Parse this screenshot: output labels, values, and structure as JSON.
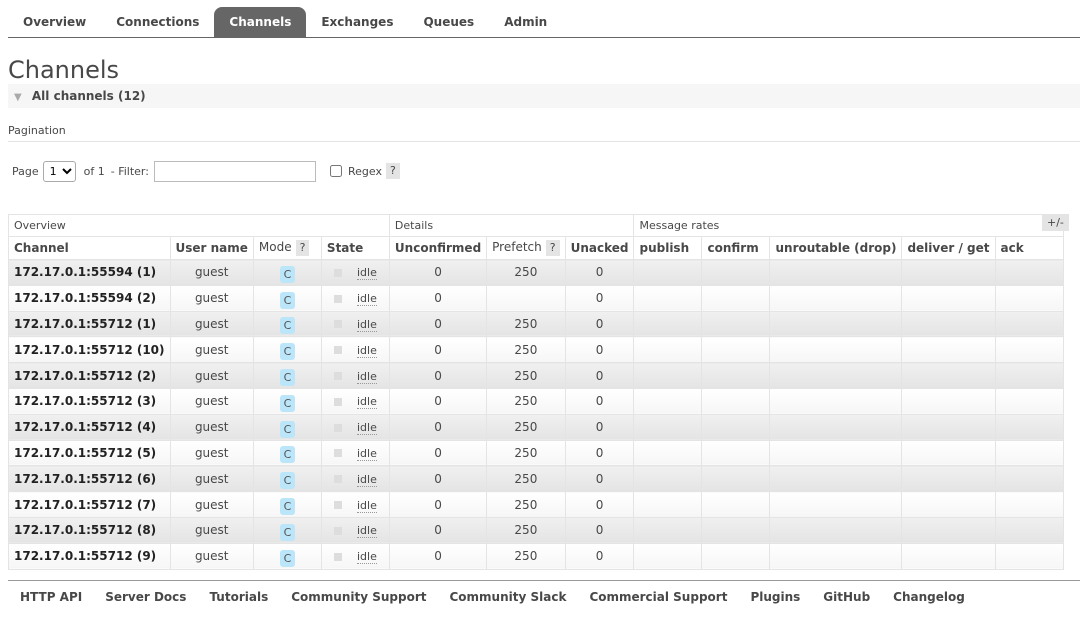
{
  "menu": {
    "tabs": [
      {
        "label": "Overview",
        "active": false
      },
      {
        "label": "Connections",
        "active": false
      },
      {
        "label": "Channels",
        "active": true
      },
      {
        "label": "Exchanges",
        "active": false
      },
      {
        "label": "Queues",
        "active": false
      },
      {
        "label": "Admin",
        "active": false
      }
    ]
  },
  "page": {
    "title": "Channels",
    "section_label": "All channels (12)"
  },
  "pagination": {
    "title": "Pagination",
    "page_label": "Page",
    "page_value": "1",
    "of_label": "of 1",
    "filter_label": "- Filter:",
    "filter_value": "",
    "regex_label": "Regex",
    "regex_checked": false,
    "help": "?"
  },
  "table": {
    "groups": [
      "Overview",
      "Details",
      "Message rates"
    ],
    "plus_minus": "+/-",
    "columns": {
      "channel": "Channel",
      "user": "User name",
      "mode": "Mode",
      "state": "State",
      "unconfirmed": "Unconfirmed",
      "prefetch": "Prefetch",
      "unacked": "Unacked",
      "publish": "publish",
      "confirm": "confirm",
      "unroutable": "unroutable (drop)",
      "deliver": "deliver / get",
      "ack": "ack",
      "help": "?"
    },
    "rows": [
      {
        "channel": "172.17.0.1:55594 (1)",
        "user": "guest",
        "mode": "C",
        "state": "idle",
        "unconfirmed": "0",
        "prefetch": "250",
        "unacked": "0"
      },
      {
        "channel": "172.17.0.1:55594 (2)",
        "user": "guest",
        "mode": "C",
        "state": "idle",
        "unconfirmed": "0",
        "prefetch": "",
        "unacked": "0"
      },
      {
        "channel": "172.17.0.1:55712 (1)",
        "user": "guest",
        "mode": "C",
        "state": "idle",
        "unconfirmed": "0",
        "prefetch": "250",
        "unacked": "0"
      },
      {
        "channel": "172.17.0.1:55712 (10)",
        "user": "guest",
        "mode": "C",
        "state": "idle",
        "unconfirmed": "0",
        "prefetch": "250",
        "unacked": "0"
      },
      {
        "channel": "172.17.0.1:55712 (2)",
        "user": "guest",
        "mode": "C",
        "state": "idle",
        "unconfirmed": "0",
        "prefetch": "250",
        "unacked": "0"
      },
      {
        "channel": "172.17.0.1:55712 (3)",
        "user": "guest",
        "mode": "C",
        "state": "idle",
        "unconfirmed": "0",
        "prefetch": "250",
        "unacked": "0"
      },
      {
        "channel": "172.17.0.1:55712 (4)",
        "user": "guest",
        "mode": "C",
        "state": "idle",
        "unconfirmed": "0",
        "prefetch": "250",
        "unacked": "0"
      },
      {
        "channel": "172.17.0.1:55712 (5)",
        "user": "guest",
        "mode": "C",
        "state": "idle",
        "unconfirmed": "0",
        "prefetch": "250",
        "unacked": "0"
      },
      {
        "channel": "172.17.0.1:55712 (6)",
        "user": "guest",
        "mode": "C",
        "state": "idle",
        "unconfirmed": "0",
        "prefetch": "250",
        "unacked": "0"
      },
      {
        "channel": "172.17.0.1:55712 (7)",
        "user": "guest",
        "mode": "C",
        "state": "idle",
        "unconfirmed": "0",
        "prefetch": "250",
        "unacked": "0"
      },
      {
        "channel": "172.17.0.1:55712 (8)",
        "user": "guest",
        "mode": "C",
        "state": "idle",
        "unconfirmed": "0",
        "prefetch": "250",
        "unacked": "0"
      },
      {
        "channel": "172.17.0.1:55712 (9)",
        "user": "guest",
        "mode": "C",
        "state": "idle",
        "unconfirmed": "0",
        "prefetch": "250",
        "unacked": "0"
      }
    ]
  },
  "footer": {
    "links": [
      "HTTP API",
      "Server Docs",
      "Tutorials",
      "Community Support",
      "Community Slack",
      "Commercial Support",
      "Plugins",
      "GitHub",
      "Changelog"
    ]
  },
  "colors": {
    "active_tab": "#666666",
    "mode_badge": "#bbe6fa",
    "text": "#484848"
  }
}
